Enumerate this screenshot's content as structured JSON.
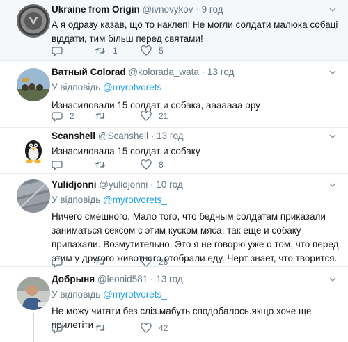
{
  "tweets": [
    {
      "name": "Ukraine from Origin",
      "handle": "@ivnovykov",
      "time": "9 год",
      "reply_label": "",
      "reply_mention": "",
      "text": "А я одразу казав, що то наклеп! Не могли солдати малюка собаці віддати, тим більш перед святами!",
      "replies": "",
      "retweets": "1",
      "likes": "5"
    },
    {
      "name": "Ватный Colorad",
      "handle": "@kolorada_wata",
      "time": "13 год",
      "reply_label": "У відповідь",
      "reply_mention": "@myrotvorets_",
      "text": "Изнасиловали 15 солдат и собака, ааааааа ору",
      "replies": "2",
      "retweets": "",
      "likes": "21"
    },
    {
      "name": "Scanshell",
      "handle": "@Scanshell",
      "time": "13 год",
      "reply_label": "",
      "reply_mention": "",
      "text": "Изнасиловала 15 солдат и собаку",
      "replies": "",
      "retweets": "",
      "likes": "8"
    },
    {
      "name": "Yulidjonni",
      "handle": "@yulidjonni",
      "time": "10 год",
      "reply_label": "У відповідь",
      "reply_mention": "@myrotvorets_",
      "text": "Ничего смешного. Мало того, что бедным солдатам приказали заниматься сексом с этим куском мяса, так еще и собаку припахали. Возмутительно. Это я не говорю уже о том, что перед этим у другого животного отобрали еду. Черт знает, что творится.",
      "replies": "",
      "retweets": "",
      "likes": "28"
    },
    {
      "name": "Добрыня",
      "handle": "@leonid581",
      "time": "13 год",
      "reply_label": "У відповідь",
      "reply_mention": "@myrotvorets_",
      "text": "Не можу читати без сліз.мабуть сподобалось.якщо хоче ще прилетіти",
      "replies": "",
      "retweets": "",
      "likes": "42"
    }
  ],
  "colors": {
    "name": "#14171a",
    "meta": "#657786",
    "mention": "#1da1f2",
    "divider": "#e6ecf0",
    "highlight_bg": "#f5f8fa"
  },
  "icons": [
    "reply-icon",
    "retweet-icon",
    "like-icon",
    "chevron-down-icon"
  ]
}
